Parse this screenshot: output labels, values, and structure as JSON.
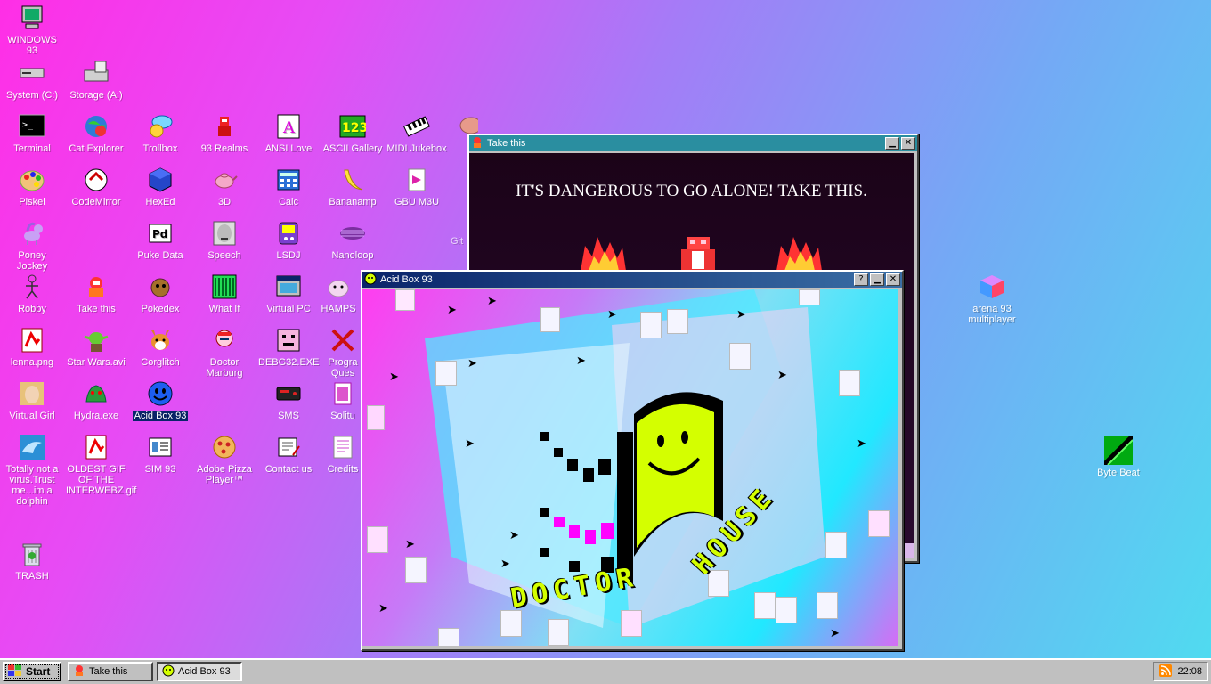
{
  "desktop": {
    "icons": [
      {
        "label": "WINDOWS 93",
        "icon": "computer-icon"
      },
      {
        "label": "System (C:)",
        "icon": "drive-icon"
      },
      {
        "label": "Storage (A:)",
        "icon": "floppy-drive-icon"
      },
      {
        "label": "Terminal",
        "icon": "terminal-icon"
      },
      {
        "label": "Cat Explorer",
        "icon": "globe-cat-icon"
      },
      {
        "label": "Trollbox",
        "icon": "chat-bubble-icon"
      },
      {
        "label": "93 Realms",
        "icon": "knight-icon"
      },
      {
        "label": "ANSI Love",
        "icon": "pencil-a-icon"
      },
      {
        "label": "ASCII Gallery",
        "icon": "numbers-icon"
      },
      {
        "label": "MIDI Jukebox",
        "icon": "piano-icon"
      },
      {
        "label": "Piskel",
        "icon": "palette-icon"
      },
      {
        "label": "CodeMirror",
        "icon": "codemirror-icon"
      },
      {
        "label": "HexEd",
        "icon": "hex-cube-icon"
      },
      {
        "label": "3D",
        "icon": "teapot-icon"
      },
      {
        "label": "Calc",
        "icon": "calculator-icon"
      },
      {
        "label": "Bananamp",
        "icon": "banana-icon"
      },
      {
        "label": "GBU M3U",
        "icon": "playlist-file-icon"
      },
      {
        "label": "Poney Jockey",
        "icon": "pony-icon"
      },
      {
        "label": "Puke Data",
        "icon": "pd-icon"
      },
      {
        "label": "Speech",
        "icon": "speech-face-icon"
      },
      {
        "label": "LSDJ",
        "icon": "lsdj-icon"
      },
      {
        "label": "Nanoloop",
        "icon": "nanoloop-icon"
      },
      {
        "label": "Robby",
        "icon": "stick-figure-icon"
      },
      {
        "label": "Take this",
        "icon": "take-this-icon"
      },
      {
        "label": "Pokedex",
        "icon": "pokedex-icon"
      },
      {
        "label": "What If",
        "icon": "what-if-icon"
      },
      {
        "label": "Virtual PC",
        "icon": "virtual-pc-icon"
      },
      {
        "label": "HAMPS",
        "icon": "hamster-icon"
      },
      {
        "label": "lenna.png",
        "icon": "image-file-icon"
      },
      {
        "label": "Star Wars.avi",
        "icon": "yoda-icon"
      },
      {
        "label": "Corglitch",
        "icon": "corgi-icon"
      },
      {
        "label": "Doctor Marburg",
        "icon": "doctor-icon"
      },
      {
        "label": "DEBG32.EXE",
        "icon": "debug-face-icon"
      },
      {
        "label": "Progra Ques",
        "icon": "quest-icon"
      },
      {
        "label": "Virtual Girl",
        "icon": "virtual-girl-icon"
      },
      {
        "label": "Hydra.exe",
        "icon": "dragon-icon"
      },
      {
        "label": "Acid Box 93",
        "icon": "blue-smiley-icon"
      },
      {
        "label": "SMS",
        "icon": "console-icon"
      },
      {
        "label": "Solitu",
        "icon": "cards-icon"
      },
      {
        "label": "Totally not a virus.Trust me...im a dolphin",
        "icon": "dolphin-icon"
      },
      {
        "label": "OLDEST GIF OF THE INTERWEBZ.gif",
        "icon": "gif-file-icon"
      },
      {
        "label": "SIM 93",
        "icon": "sim-icon"
      },
      {
        "label": "Adobe Pizza Player™",
        "icon": "pizza-icon"
      },
      {
        "label": "Contact us",
        "icon": "contact-icon"
      },
      {
        "label": "Credits",
        "icon": "credits-icon"
      },
      {
        "label": "TRASH",
        "icon": "trash-icon"
      },
      {
        "label": "arena 93 multiplayer",
        "icon": "cube-icon"
      },
      {
        "label": "Byte Beat",
        "icon": "bytebeat-icon"
      },
      {
        "label": "Git",
        "icon": "git-icon"
      }
    ]
  },
  "windows": {
    "take_this": {
      "title": "Take this",
      "message": "IT'S DANGEROUS TO GO ALONE! TAKE THIS."
    },
    "acid_box": {
      "title": "Acid Box 93",
      "word_bottom": "DOCTOR",
      "word_right": "HOUSE"
    }
  },
  "taskbar": {
    "start_label": "Start",
    "tasks": [
      {
        "label": "Take this",
        "active": false
      },
      {
        "label": "Acid Box 93",
        "active": true
      }
    ],
    "clock": "22:08"
  },
  "colors": {
    "titlebar_active": "#0a246a",
    "titlebar_inactive": "#2a8ea0",
    "selection": "#0a246a",
    "acid_smiley": "#d4ff00"
  }
}
